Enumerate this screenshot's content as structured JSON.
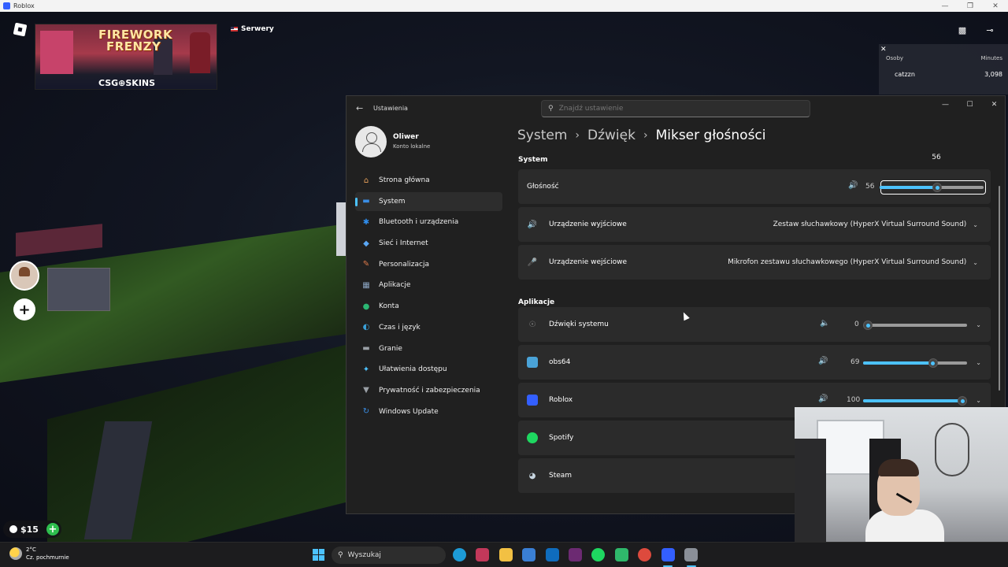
{
  "roblox": {
    "window_title": "Roblox",
    "ad_title_line1": "FIREWORK",
    "ad_title_line2": "FRENZY",
    "ad_brand": "CSG⊕SKINS",
    "servers_label": "Serwery",
    "leaderboard": {
      "close": "✕",
      "col_people": "Osoby",
      "col_minutes": "Minutes",
      "rows": [
        {
          "name": "catzzn",
          "value": "3,098"
        }
      ]
    },
    "currency": "$15",
    "add_label": "+"
  },
  "settings": {
    "app_title": "Ustawienia",
    "search_placeholder": "Znajdź ustawienie",
    "user": {
      "name": "Oliwer",
      "account_type": "Konto lokalne"
    },
    "nav": [
      {
        "label": "Strona główna",
        "icon": "home-icon",
        "color": "#e8a15a"
      },
      {
        "label": "System",
        "icon": "monitor-icon",
        "color": "#3a8ee6",
        "active": true
      },
      {
        "label": "Bluetooth i urządzenia",
        "icon": "bluetooth-icon",
        "color": "#2f8ff0"
      },
      {
        "label": "Sieć i Internet",
        "icon": "wifi-icon",
        "color": "#5aa7f5"
      },
      {
        "label": "Personalizacja",
        "icon": "brush-icon",
        "color": "#e07a4a"
      },
      {
        "label": "Aplikacje",
        "icon": "apps-icon",
        "color": "#8aa3c0"
      },
      {
        "label": "Konta",
        "icon": "person-icon",
        "color": "#2bb673"
      },
      {
        "label": "Czas i język",
        "icon": "globe-icon",
        "color": "#3aa0d8"
      },
      {
        "label": "Granie",
        "icon": "gamepad-icon",
        "color": "#9aa0a6"
      },
      {
        "label": "Ułatwienia dostępu",
        "icon": "accessibility-icon",
        "color": "#4cc2ff"
      },
      {
        "label": "Prywatność i zabezpieczenia",
        "icon": "shield-icon",
        "color": "#9aa0a6"
      },
      {
        "label": "Windows Update",
        "icon": "update-icon",
        "color": "#3a8ee6"
      }
    ],
    "breadcrumb": [
      "System",
      "Dźwięk",
      "Mikser głośności"
    ],
    "system_section": "System",
    "volume": {
      "label": "Głośność",
      "value": 56,
      "value_text": "56",
      "tooltip": "56"
    },
    "output": {
      "label": "Urządzenie wyjściowe",
      "value": "Zestaw słuchawkowy (HyperX Virtual Surround Sound)"
    },
    "input": {
      "label": "Urządzenie wejściowe",
      "value": "Mikrofon zestawu słuchawkowego (HyperX Virtual Surround Sound)"
    },
    "apps_section": "Aplikacje",
    "apps": [
      {
        "name": "Dźwięki systemu",
        "value": 0,
        "value_text": "0",
        "icon": "headphones-icon",
        "color": "#888888",
        "muted": true
      },
      {
        "name": "obs64",
        "value": 69,
        "value_text": "69",
        "icon": "obs-icon",
        "color": "#4aa3d8"
      },
      {
        "name": "Roblox",
        "value": 100,
        "value_text": "100",
        "icon": "roblox-icon",
        "color": "#335fff"
      },
      {
        "name": "Spotify",
        "icon": "spotify-icon",
        "color": "#1ed760"
      },
      {
        "name": "Steam",
        "icon": "steam-icon",
        "color": "#c7d5e0"
      }
    ]
  },
  "taskbar": {
    "temperature": "2°C",
    "weather": "Cz. pochmurnie",
    "search_label": "Wyszukaj",
    "apps": [
      {
        "name": "edge-icon",
        "color": "#1d9bd7"
      },
      {
        "name": "snipping-icon",
        "color": "#c2385a"
      },
      {
        "name": "explorer-icon",
        "color": "#f2c043"
      },
      {
        "name": "store-icon",
        "color": "#3a7fd5"
      },
      {
        "name": "outlook-icon",
        "color": "#0f6cbd"
      },
      {
        "name": "slack-icon",
        "color": "#6c2a72"
      },
      {
        "name": "spotify-icon",
        "color": "#1ed760"
      },
      {
        "name": "discord-icon",
        "color": "#2fb86b"
      },
      {
        "name": "chrome-icon",
        "color": "#dd4a3d"
      },
      {
        "name": "roblox-icon",
        "color": "#335fff"
      },
      {
        "name": "settings-icon",
        "color": "#8a8f98"
      }
    ]
  }
}
